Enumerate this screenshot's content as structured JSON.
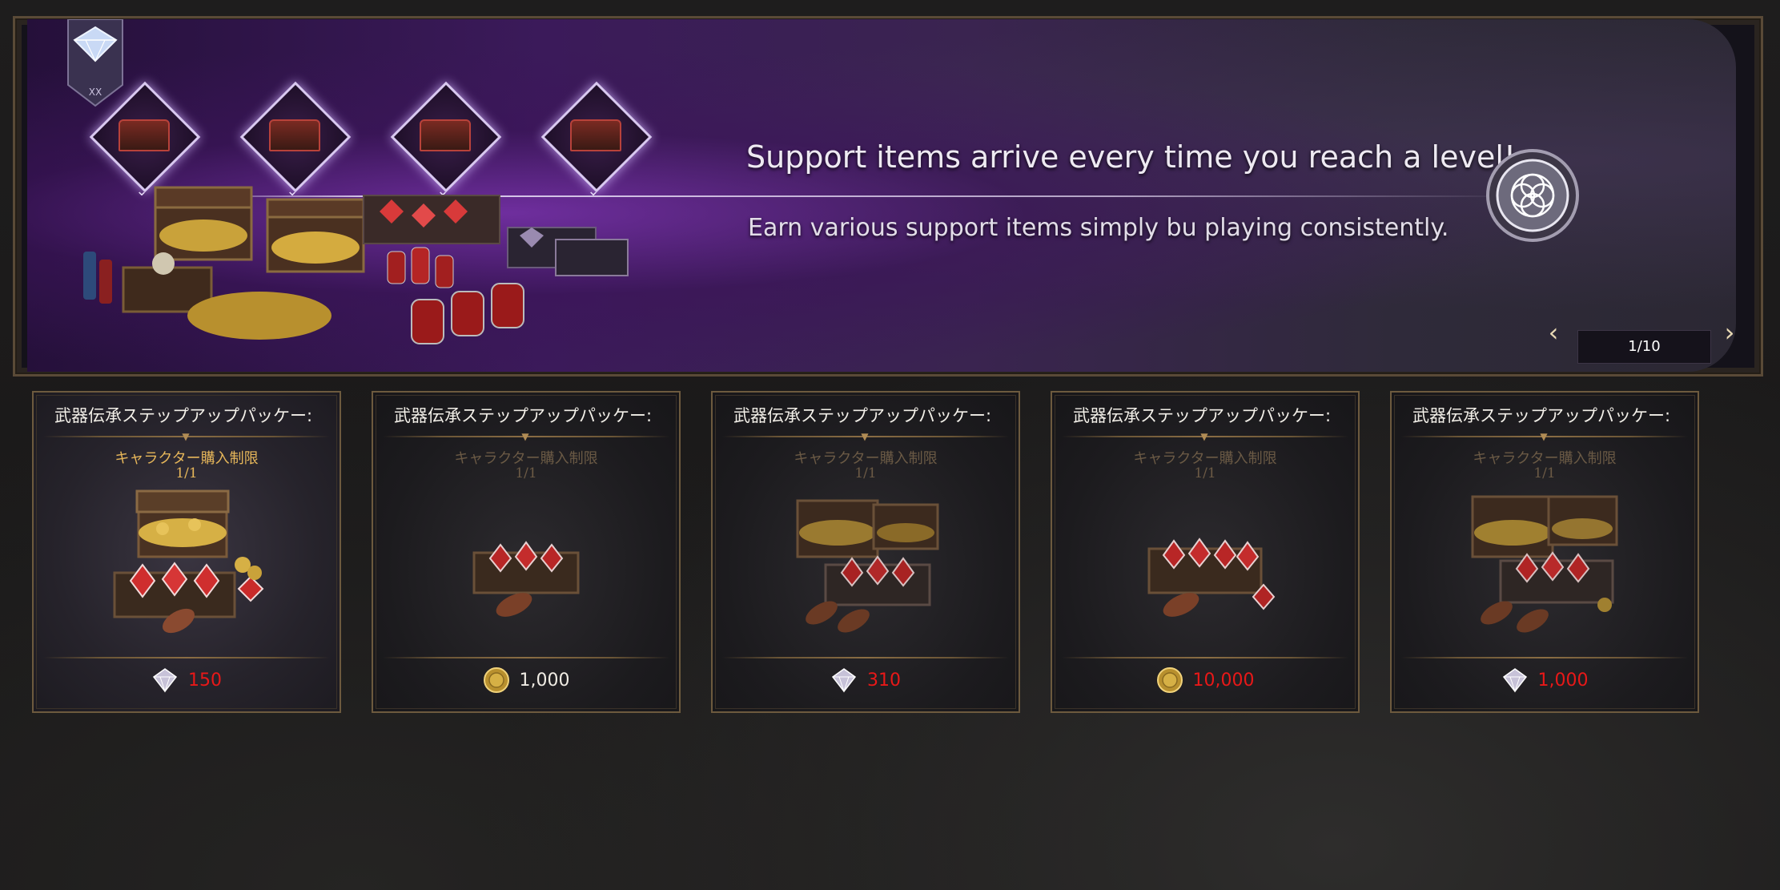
{
  "banner": {
    "headline": "Support items arrive every time you reach a level!",
    "subline": "Earn various support items simply bu playing consistently.",
    "pager": "1/10",
    "reward_icons": [
      "chest-icon",
      "chest-icon",
      "chest-icon",
      "chest-icon"
    ]
  },
  "cards": [
    {
      "title": "武器伝承ステップアップパッケー:",
      "limit_label": "キャラクター購入制限",
      "limit_count": "1/1",
      "price": "150",
      "currency": "crystal-icon",
      "price_color": "#e81818"
    },
    {
      "title": "武器伝承ステップアップパッケー:",
      "limit_label": "キャラクター購入制限",
      "limit_count": "1/1",
      "price": "1,000",
      "currency": "gold-coin-icon",
      "price_color": "#f0ece4"
    },
    {
      "title": "武器伝承ステップアップパッケー:",
      "limit_label": "キャラクター購入制限",
      "limit_count": "1/1",
      "price": "310",
      "currency": "crystal-icon",
      "price_color": "#e81818"
    },
    {
      "title": "武器伝承ステップアップパッケー:",
      "limit_label": "キャラクター購入制限",
      "limit_count": "1/1",
      "price": "10,000",
      "currency": "gold-coin-icon",
      "price_color": "#e81818"
    },
    {
      "title": "武器伝承ステップアップパッケー:",
      "limit_label": "キャラクター購入制限",
      "limit_count": "1/1",
      "price": "1,000",
      "currency": "crystal-icon",
      "price_color": "#e81818"
    }
  ],
  "colors": {
    "accent_gold": "#e7b75a",
    "price_red": "#e81818",
    "frame_bronze": "#6d5a3e"
  }
}
